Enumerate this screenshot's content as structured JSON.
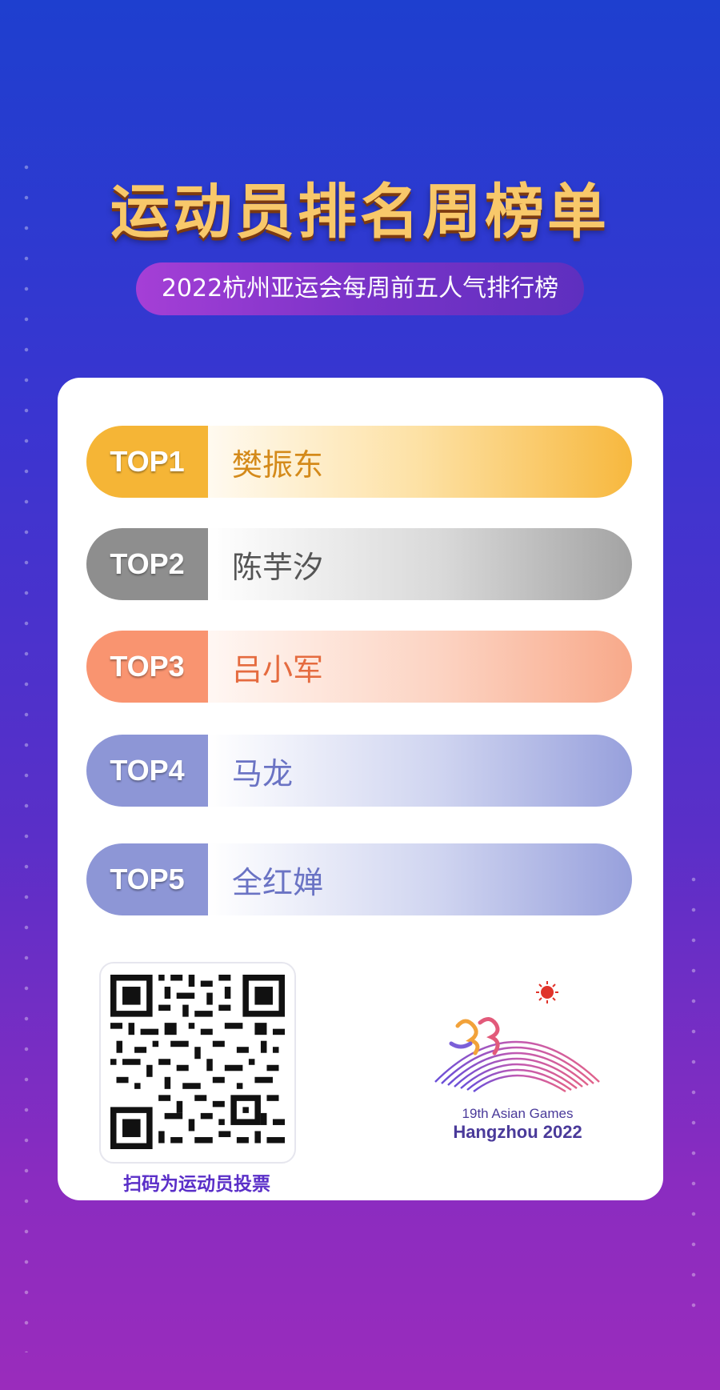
{
  "header": {
    "title": "运动员排名周榜单",
    "subtitle": "2022杭州亚运会每周前五人气排行榜"
  },
  "ranking": [
    {
      "tag": "TOP1",
      "name": "樊振东"
    },
    {
      "tag": "TOP2",
      "name": "陈芋汐"
    },
    {
      "tag": "TOP3",
      "name": "吕小军"
    },
    {
      "tag": "TOP4",
      "name": "马龙"
    },
    {
      "tag": "TOP5",
      "name": "全红婵"
    }
  ],
  "footer": {
    "qr_caption": "扫码为运动员投票",
    "logo_line1": "19th Asian Games",
    "logo_line2": "Hangzhou 2022"
  },
  "colors": {
    "top1": "#f5b536",
    "top2": "#8e8e8e",
    "top3": "#f99470",
    "top4": "#8d96d6",
    "top5": "#8d96d6"
  }
}
